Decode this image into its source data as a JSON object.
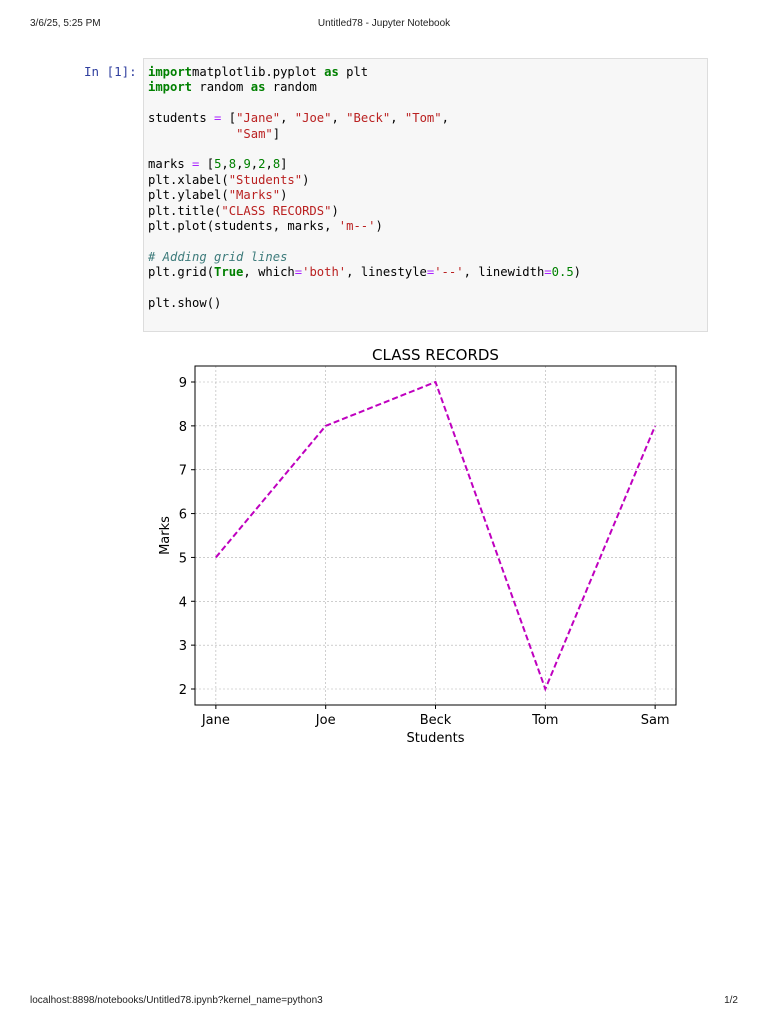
{
  "page_header": {
    "datetime": "3/6/25, 5:25 PM",
    "title": "Untitled78 - Jupyter Notebook"
  },
  "page_footer": {
    "url": "localhost:8898/notebooks/Untitled78.ipynb?kernel_name=python3",
    "page": "1/2"
  },
  "cell": {
    "prompt": "In [1]:",
    "code_lines": [
      [
        [
          "kw",
          "import"
        ],
        [
          "",
          "matplotlib.pyplot "
        ],
        [
          "kw",
          "as"
        ],
        [
          "",
          " plt"
        ]
      ],
      [
        [
          "kw",
          "import"
        ],
        [
          "",
          " random "
        ],
        [
          "kw",
          "as"
        ],
        [
          "",
          " random"
        ]
      ],
      [],
      [
        [
          "",
          "students "
        ],
        [
          "op",
          "="
        ],
        [
          "",
          " ["
        ],
        [
          "str",
          "\"Jane\""
        ],
        [
          "",
          ", "
        ],
        [
          "str",
          "\"Joe\""
        ],
        [
          "",
          ", "
        ],
        [
          "str",
          "\"Beck\""
        ],
        [
          "",
          ", "
        ],
        [
          "str",
          "\"Tom\""
        ],
        [
          "",
          ","
        ]
      ],
      [
        [
          "",
          "            "
        ],
        [
          "str",
          "\"Sam\""
        ],
        [
          "",
          "]"
        ]
      ],
      [],
      [
        [
          "",
          "marks "
        ],
        [
          "op",
          "="
        ],
        [
          "",
          " ["
        ],
        [
          "num",
          "5"
        ],
        [
          "",
          ","
        ],
        [
          "num",
          "8"
        ],
        [
          "",
          ","
        ],
        [
          "num",
          "9"
        ],
        [
          "",
          ","
        ],
        [
          "num",
          "2"
        ],
        [
          "",
          ","
        ],
        [
          "num",
          "8"
        ],
        [
          "",
          "]"
        ]
      ],
      [
        [
          "",
          "plt.xlabel("
        ],
        [
          "str",
          "\"Students\""
        ],
        [
          "",
          ")"
        ]
      ],
      [
        [
          "",
          "plt.ylabel("
        ],
        [
          "str",
          "\"Marks\""
        ],
        [
          "",
          ")"
        ]
      ],
      [
        [
          "",
          "plt.title("
        ],
        [
          "str",
          "\"CLASS RECORDS\""
        ],
        [
          "",
          ")"
        ]
      ],
      [
        [
          "",
          "plt.plot(students, marks, "
        ],
        [
          "str",
          "'m--'"
        ],
        [
          "",
          ")"
        ]
      ],
      [],
      [
        [
          "cm",
          "# Adding grid lines"
        ]
      ],
      [
        [
          "",
          "plt.grid("
        ],
        [
          "kw",
          "True"
        ],
        [
          "",
          ", which"
        ],
        [
          "op",
          "="
        ],
        [
          "str",
          "'both'"
        ],
        [
          "",
          ", linestyle"
        ],
        [
          "op",
          "="
        ],
        [
          "str",
          "'--'"
        ],
        [
          "",
          ", linewidth"
        ],
        [
          "op",
          "="
        ],
        [
          "num",
          "0.5"
        ],
        [
          "",
          ")"
        ]
      ],
      [],
      [
        [
          "",
          "plt.show()"
        ]
      ]
    ]
  },
  "chart_data": {
    "type": "line",
    "title": "CLASS RECORDS",
    "xlabel": "Students",
    "ylabel": "Marks",
    "categories": [
      "Jane",
      "Joe",
      "Beck",
      "Tom",
      "Sam"
    ],
    "values": [
      5,
      8,
      9,
      2,
      8
    ],
    "yticks": [
      2,
      3,
      4,
      5,
      6,
      7,
      8,
      9
    ],
    "ylim": [
      1.635,
      9.365
    ],
    "xlim": [
      -0.19,
      4.19
    ],
    "grid": true,
    "line_style": "dashed",
    "color": "#bf00bf"
  }
}
